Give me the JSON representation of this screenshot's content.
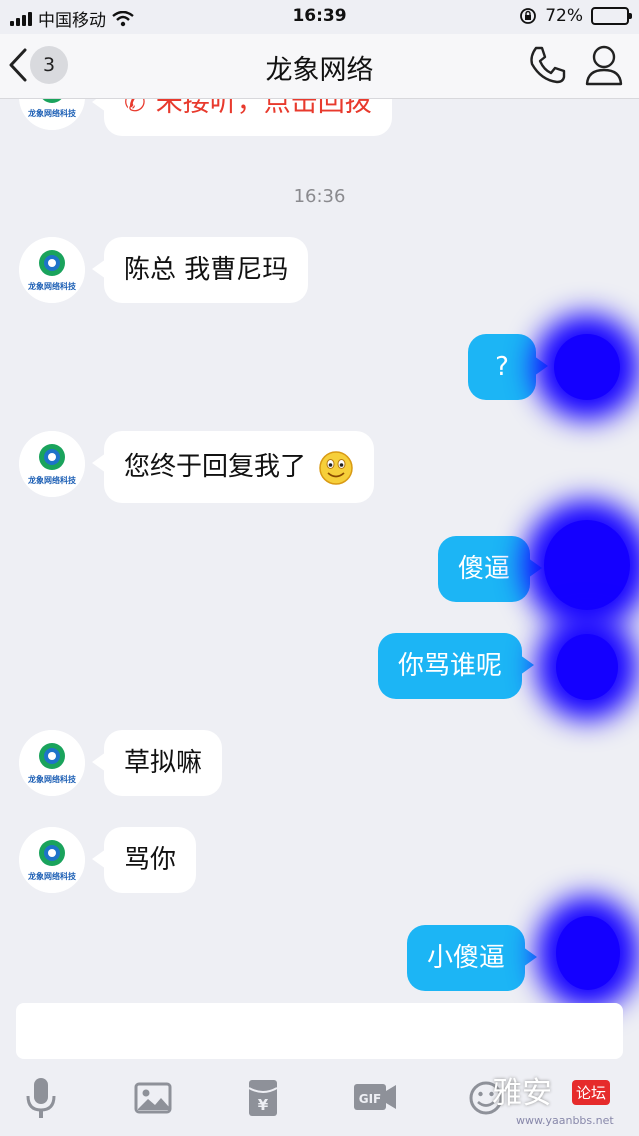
{
  "status_bar": {
    "carrier": "中国移动",
    "time": "16:39",
    "battery": "72%"
  },
  "nav": {
    "unread_count": "3",
    "title": "龙象网络"
  },
  "messages": {
    "missed_call": "未接听，点击回拨",
    "timestamp": "16:36",
    "m1": "陈总  我曹尼玛",
    "m2": "?",
    "m3": "您终于回复我了",
    "m4": "傻逼",
    "m5": "你骂谁呢",
    "m6": "草拟嘛",
    "m7": "骂你",
    "m8": "小傻逼"
  },
  "avatar_caption": "龙象网络科技",
  "watermark": {
    "cn": "雅安",
    "tag": "论坛",
    "url": "www.yaanbbs.net"
  },
  "colors": {
    "outgoing_bubble": "#1cb5f5",
    "incoming_bubble": "#ffffff",
    "background": "#eeeff4",
    "missed_call": "#e83a2d",
    "redaction": "#1400ff"
  },
  "icons": [
    "signal-icon",
    "wifi-icon",
    "orientation-lock-icon",
    "battery-icon",
    "back-chevron-icon",
    "phone-icon",
    "person-icon",
    "microphone-icon",
    "image-icon",
    "red-packet-icon",
    "gif-icon",
    "emoji-icon"
  ]
}
